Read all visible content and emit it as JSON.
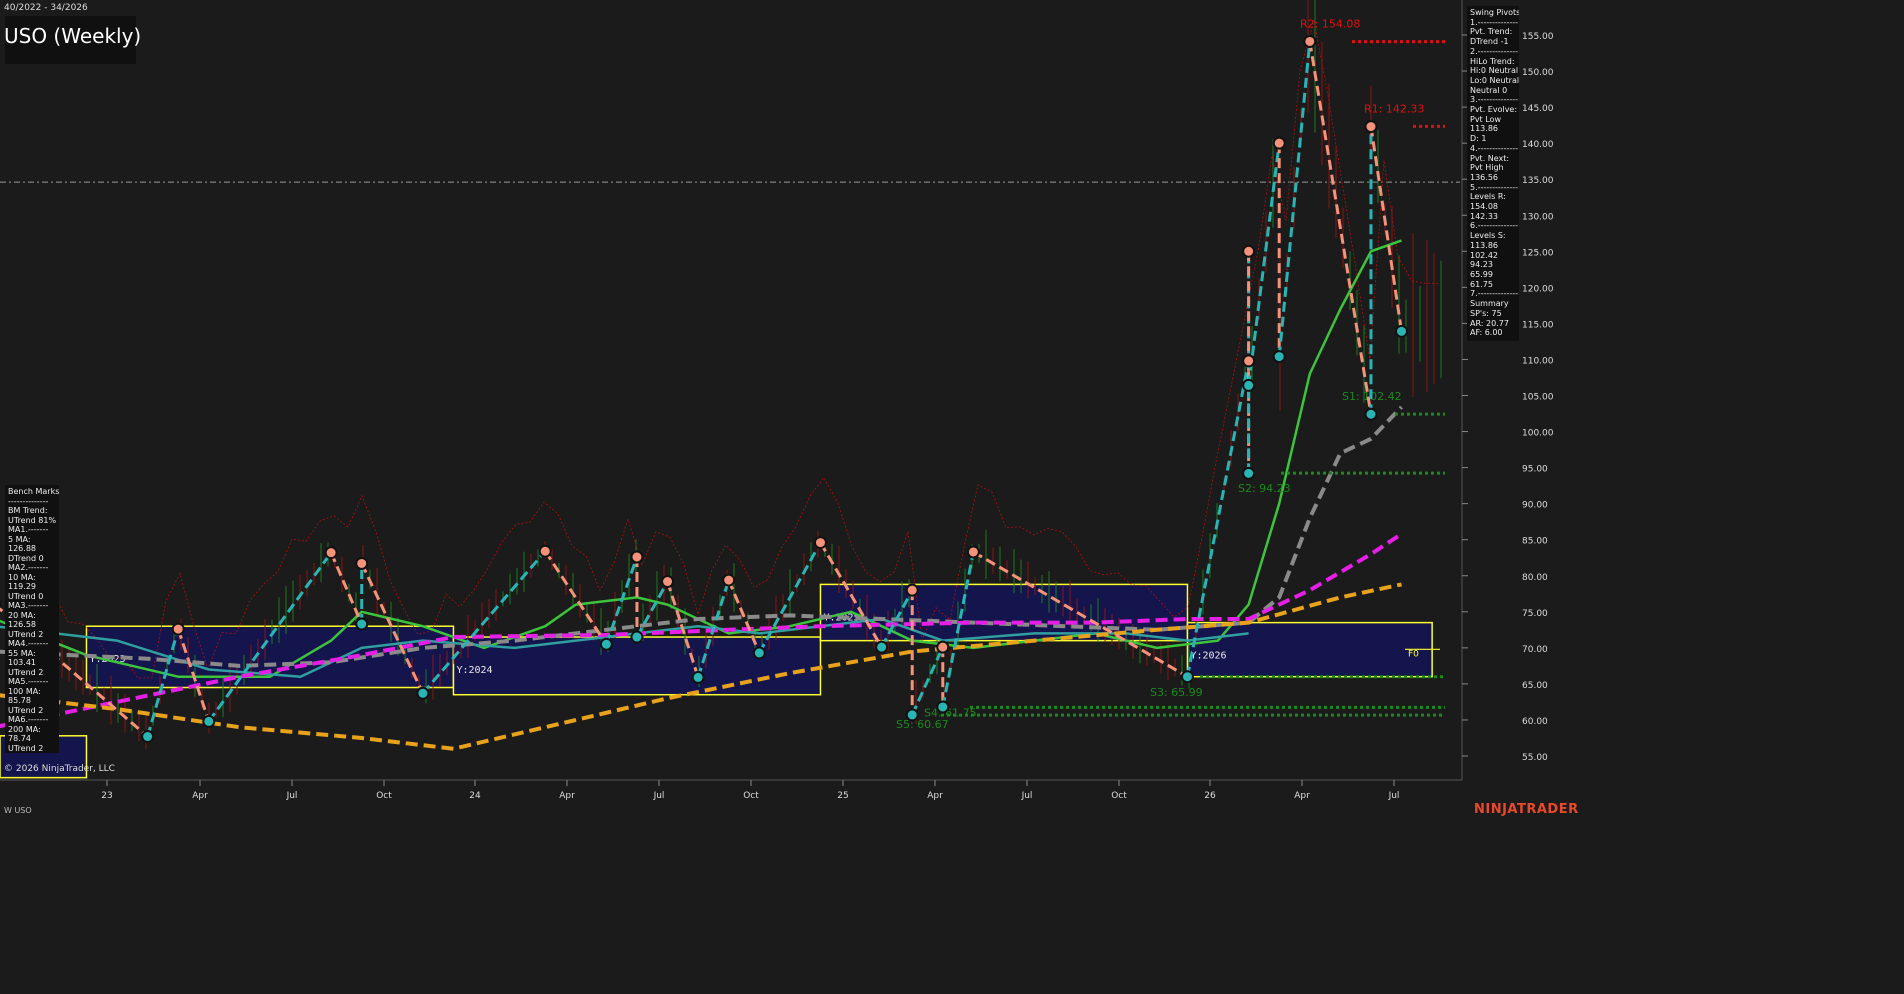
{
  "header": {
    "date_range": "40/2022 - 34/2026",
    "title": "USO (Weekly)"
  },
  "colors": {
    "background": "#1b1b1b",
    "resistance": "#e01010",
    "support": "#1a8a1a",
    "pivot_high": "#f4937a",
    "pivot_low": "#2ab5b5",
    "ma_green": "#3dc43d",
    "ma_gray": "#8a8a8a",
    "ma_magenta": "#e61fe6",
    "ma_orange": "#e8a21c",
    "year_box": "#ffff2e",
    "year_box_fill": "#14145a"
  },
  "chart_data": {
    "type": "line",
    "title": "USO (Weekly)",
    "period": "40/2022 - 34/2026",
    "ylim": [
      52,
      158
    ],
    "y_ticks": [
      "155.00",
      "150.00",
      "145.00",
      "140.00",
      "135.00",
      "130.00",
      "125.00",
      "120.00",
      "115.00",
      "110.00",
      "105.00",
      "100.00",
      "95.00",
      "90.00",
      "85.00",
      "80.00",
      "75.00",
      "70.00",
      "65.00",
      "60.00",
      "55.00"
    ],
    "x_ticks": [
      "23",
      "Apr",
      "Jul",
      "Oct",
      "24",
      "Apr",
      "Jul",
      "Oct",
      "25",
      "Apr",
      "Jul",
      "Oct",
      "26",
      "Apr",
      "Jul"
    ],
    "current_price_line": 134.6,
    "swing_pivots": [
      {
        "type": "high",
        "date": "2022-10",
        "value": 76
      },
      {
        "type": "low",
        "date": "2023-03",
        "value": 57.7
      },
      {
        "type": "high",
        "date": "2023-04",
        "value": 72.6
      },
      {
        "type": "low",
        "date": "2023-05",
        "value": 59.8
      },
      {
        "type": "high",
        "date": "2023-09",
        "value": 83.2
      },
      {
        "type": "low",
        "date": "2023-10",
        "value": 73.3
      },
      {
        "type": "high",
        "date": "2023-10",
        "value": 81.7
      },
      {
        "type": "low",
        "date": "2023-12",
        "value": 63.7
      },
      {
        "type": "high",
        "date": "2024-04",
        "value": 83.4
      },
      {
        "type": "low",
        "date": "2024-06",
        "value": 70.5
      },
      {
        "type": "high",
        "date": "2024-07",
        "value": 82.6
      },
      {
        "type": "low",
        "date": "2024-07",
        "value": 71.5
      },
      {
        "type": "high",
        "date": "2024-08",
        "value": 79.2
      },
      {
        "type": "low",
        "date": "2024-09",
        "value": 65.9
      },
      {
        "type": "high",
        "date": "2024-10",
        "value": 79.4
      },
      {
        "type": "low",
        "date": "2024-11",
        "value": 69.3
      },
      {
        "type": "high",
        "date": "2025-01",
        "value": 84.6
      },
      {
        "type": "low",
        "date": "2025-03",
        "value": 70.1
      },
      {
        "type": "high",
        "date": "2025-04",
        "value": 78.0
      },
      {
        "type": "low",
        "date": "2025-04",
        "value": 60.7
      },
      {
        "type": "high",
        "date": "2025-05",
        "value": 70.1
      },
      {
        "type": "low",
        "date": "2025-05",
        "value": 61.8
      },
      {
        "type": "high",
        "date": "2025-06",
        "value": 83.3
      },
      {
        "type": "low",
        "date": "2026-01",
        "value": 66.0
      },
      {
        "type": "high",
        "date": "2026-03",
        "value": 109.8
      },
      {
        "type": "low",
        "date": "2026-03",
        "value": 94.2
      },
      {
        "type": "high",
        "date": "2026-03",
        "value": 125.0
      },
      {
        "type": "low",
        "date": "2026-03",
        "value": 106.4
      },
      {
        "type": "high",
        "date": "2026-04",
        "value": 140.0
      },
      {
        "type": "low",
        "date": "2026-04",
        "value": 110.4
      },
      {
        "type": "high",
        "date": "2026-05",
        "value": 154.1
      },
      {
        "type": "low",
        "date": "2026-07",
        "value": 102.4
      },
      {
        "type": "high",
        "date": "2026-07",
        "value": 142.3
      },
      {
        "type": "low",
        "date": "2026-08",
        "value": 113.9
      }
    ],
    "levels": [
      {
        "label": "R2: 154.08",
        "value": 154.08,
        "kind": "resistance"
      },
      {
        "label": "R1: 142.33",
        "value": 142.33,
        "kind": "resistance"
      },
      {
        "label": "S1: 102.42",
        "value": 102.42,
        "kind": "support"
      },
      {
        "label": "S2: 94.23",
        "value": 94.23,
        "kind": "support"
      },
      {
        "label": "S3: 65.99",
        "value": 65.99,
        "kind": "support"
      },
      {
        "label": "S4: 61.75",
        "value": 61.75,
        "kind": "support"
      },
      {
        "label": "S5: 60.67",
        "value": 60.67,
        "kind": "support"
      }
    ],
    "year_boxes": [
      {
        "label": "Y:2023",
        "start": "2023-01",
        "end": "2024-01",
        "high": 73.0,
        "low": 64.5
      },
      {
        "label": "Y:2024",
        "start": "2024-01",
        "end": "2025-01",
        "high": 71.5,
        "low": 63.5
      },
      {
        "label": "Y:2025",
        "start": "2025-01",
        "end": "2026-01",
        "high": 78.8,
        "low": 71.0
      },
      {
        "label": "Y:2026",
        "start": "2026-01",
        "end": "2026-09",
        "high": 73.5,
        "low": 66.0
      },
      {
        "label": "",
        "start": "2022-10",
        "end": "2023-01",
        "high": 57.8,
        "low": 52
      }
    ],
    "f0_label": "F0",
    "f0_value": 69.8,
    "series": [
      {
        "style": "solid",
        "color": "#3dc43d",
        "points": [
          [
            "2022-10",
            74
          ],
          [
            "2023-01",
            69
          ],
          [
            "2023-04",
            66
          ],
          [
            "2023-07",
            66
          ],
          [
            "2023-09",
            71
          ],
          [
            "2023-10",
            75
          ],
          [
            "2023-12",
            73
          ],
          [
            "2024-02",
            70
          ],
          [
            "2024-04",
            73
          ],
          [
            "2024-05",
            76
          ],
          [
            "2024-07",
            77
          ],
          [
            "2024-08",
            76
          ],
          [
            "2024-10",
            72
          ],
          [
            "2024-12",
            73
          ],
          [
            "2025-02",
            75
          ],
          [
            "2025-04",
            71
          ],
          [
            "2025-06",
            70
          ],
          [
            "2025-08",
            71
          ],
          [
            "2025-10",
            72
          ],
          [
            "2025-12",
            70
          ],
          [
            "2026-02",
            71
          ],
          [
            "2026-03",
            76
          ],
          [
            "2026-04",
            90
          ],
          [
            "2026-05",
            108
          ],
          [
            "2026-06",
            117
          ],
          [
            "2026-07",
            125
          ],
          [
            "2026-08",
            126.5
          ]
        ]
      },
      {
        "style": "solid",
        "color": "#2f9f9f",
        "points": [
          [
            "2022-10",
            73
          ],
          [
            "2023-02",
            71
          ],
          [
            "2023-05",
            67
          ],
          [
            "2023-08",
            66
          ],
          [
            "2023-10",
            70
          ],
          [
            "2023-12",
            71
          ],
          [
            "2024-03",
            70
          ],
          [
            "2024-05",
            71
          ],
          [
            "2024-07",
            72
          ],
          [
            "2024-09",
            73
          ],
          [
            "2024-11",
            72
          ],
          [
            "2025-01",
            73
          ],
          [
            "2025-03",
            74
          ],
          [
            "2025-05",
            71
          ],
          [
            "2025-08",
            72
          ],
          [
            "2025-11",
            72
          ],
          [
            "2026-01",
            71
          ],
          [
            "2026-03",
            72
          ]
        ]
      },
      {
        "style": "dashed",
        "color": "#8a8a8a",
        "points": [
          [
            "2022-10",
            69.5
          ],
          [
            "2023-03",
            68.5
          ],
          [
            "2023-06",
            67.5
          ],
          [
            "2023-09",
            68
          ],
          [
            "2023-12",
            70
          ],
          [
            "2024-03",
            71
          ],
          [
            "2024-06",
            72.5
          ],
          [
            "2024-09",
            74
          ],
          [
            "2024-12",
            74.5
          ],
          [
            "2025-03",
            74
          ],
          [
            "2025-06",
            73.5
          ],
          [
            "2025-09",
            73
          ],
          [
            "2025-12",
            72.5
          ],
          [
            "2026-03",
            73.5
          ],
          [
            "2026-04",
            77
          ],
          [
            "2026-05",
            88
          ],
          [
            "2026-06",
            97
          ],
          [
            "2026-07",
            99
          ],
          [
            "2026-08",
            103.4
          ]
        ]
      },
      {
        "style": "dashed",
        "color": "#e61fe6",
        "points": [
          [
            "2022-10",
            59
          ],
          [
            "2023-02",
            62.5
          ],
          [
            "2023-06",
            66
          ],
          [
            "2023-10",
            69
          ],
          [
            "2024-01",
            71.5
          ],
          [
            "2024-06",
            71.8
          ],
          [
            "2024-10",
            72.5
          ],
          [
            "2025-01",
            73
          ],
          [
            "2025-06",
            73.5
          ],
          [
            "2025-10",
            73.5
          ],
          [
            "2026-01",
            74
          ],
          [
            "2026-03",
            74
          ],
          [
            "2026-05",
            78
          ],
          [
            "2026-07",
            83
          ],
          [
            "2026-08",
            85.8
          ]
        ]
      },
      {
        "style": "dashed",
        "color": "#e8a21c",
        "points": [
          [
            "2022-10",
            63.5
          ],
          [
            "2023-02",
            61.5
          ],
          [
            "2023-06",
            59
          ],
          [
            "2023-10",
            57.5
          ],
          [
            "2024-01",
            56
          ],
          [
            "2024-04",
            59
          ],
          [
            "2024-08",
            63
          ],
          [
            "2024-12",
            66.5
          ],
          [
            "2025-04",
            69.5
          ],
          [
            "2025-08",
            71
          ],
          [
            "2025-12",
            72.5
          ],
          [
            "2026-03",
            73.5
          ],
          [
            "2026-06",
            77
          ],
          [
            "2026-08",
            78.8
          ]
        ]
      }
    ]
  },
  "swing_panel": {
    "lines": [
      "Swing Pivots",
      "1.--------------",
      "Pvt. Trend:",
      "DTrend -1",
      "2.--------------",
      "HiLo Trend:",
      "Hi:0 Neutral",
      "Lo:0 Neutral",
      "Neutral 0",
      "3.--------------",
      "Pvt. Evolve:",
      "Pvt Low",
      "113.86",
      "D: 1",
      "4.--------------",
      "Pvt. Next:",
      "Pvt High",
      "136.56",
      "5.--------------",
      "Levels R:",
      "154.08",
      "142.33",
      "6.--------------",
      "Levels S:",
      "113.86",
      "102.42",
      "94.23",
      "65.99",
      "61.75",
      "7.--------------",
      "Summary",
      "SP's: 75",
      "AR: 20.77",
      "AF: 6.00"
    ]
  },
  "bench_panel": {
    "lines": [
      "Bench Marks",
      "--------------",
      "BM Trend:",
      "UTrend 81%",
      "MA1.-------",
      "5 MA:",
      "126.88",
      "DTrend 0",
      "MA2.-------",
      "10 MA:",
      "119.29",
      "UTrend 0",
      "MA3.-------",
      "20 MA:",
      "126.58",
      "UTrend 2",
      "MA4.-------",
      "55 MA:",
      "103.41",
      "UTrend 2",
      "MA5.-------",
      "100 MA:",
      "85.78",
      "UTrend 2",
      "MA6.-------",
      "200 MA:",
      "78.74",
      "UTrend 2"
    ]
  },
  "footer": {
    "copyright": "© 2026 NinjaTrader, LLC",
    "symbol": "W USO",
    "brand": "NINJATRADER"
  }
}
